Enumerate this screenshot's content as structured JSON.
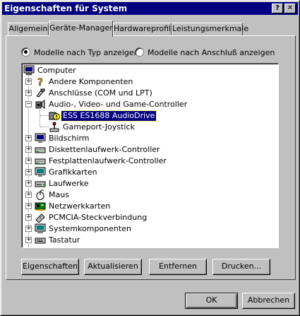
{
  "window": {
    "title": "Eigenschaften für System"
  },
  "titlebar_buttons": {
    "help": "?",
    "close": "✕"
  },
  "tabs": [
    {
      "label": "Allgemein",
      "active": false
    },
    {
      "label": "Geräte-Manager",
      "active": true
    },
    {
      "label": "Hardwareprofile",
      "active": false
    },
    {
      "label": "Leistungsmerkmale",
      "active": false
    }
  ],
  "view_options": {
    "by_type": {
      "label": "Modelle nach Typ anzeigen",
      "checked": true
    },
    "by_connection": {
      "label": "Modelle nach Anschluß anzeigen",
      "checked": false
    }
  },
  "tree": {
    "root": "Computer",
    "items": [
      {
        "label": "Andere Komponenten",
        "icon": "question-mark-icon",
        "expanded": false
      },
      {
        "label": "Anschlüsse (COM und LPT)",
        "icon": "port-icon",
        "expanded": false
      },
      {
        "label": "Audio-, Video- und Game-Controller",
        "icon": "audio-icon",
        "expanded": true,
        "children": [
          {
            "label": "ESS ES1688 AudioDrive",
            "icon": "warning-device-icon",
            "selected": true
          },
          {
            "label": "Gameport-Joystick",
            "icon": "joystick-icon",
            "selected": false
          }
        ]
      },
      {
        "label": "Bildschirm",
        "icon": "monitor-icon",
        "expanded": false
      },
      {
        "label": "Diskettenlaufwerk-Controller",
        "icon": "controller-icon",
        "expanded": false
      },
      {
        "label": "Festplattenlaufwerk-Controller",
        "icon": "controller-icon",
        "expanded": false
      },
      {
        "label": "Grafikkarten",
        "icon": "display-adapter-icon",
        "expanded": false
      },
      {
        "label": "Laufwerke",
        "icon": "drive-icon",
        "expanded": false
      },
      {
        "label": "Maus",
        "icon": "mouse-icon",
        "expanded": false
      },
      {
        "label": "Netzwerkkarten",
        "icon": "network-card-icon",
        "expanded": false
      },
      {
        "label": "PCMCIA-Steckverbindung",
        "icon": "pcmcia-icon",
        "expanded": false
      },
      {
        "label": "Systemkomponenten",
        "icon": "system-icon",
        "expanded": false
      },
      {
        "label": "Tastatur",
        "icon": "keyboard-icon",
        "expanded": false
      }
    ]
  },
  "action_buttons": {
    "properties": "Eigenschaften",
    "refresh": "Aktualisieren",
    "remove": "Entfernen",
    "print": "Drucken..."
  },
  "dialog_buttons": {
    "ok": "OK",
    "cancel": "Abbrechen"
  },
  "colors": {
    "titlebar": "#000080",
    "face": "#c0c0c0",
    "selection": "#000080"
  }
}
